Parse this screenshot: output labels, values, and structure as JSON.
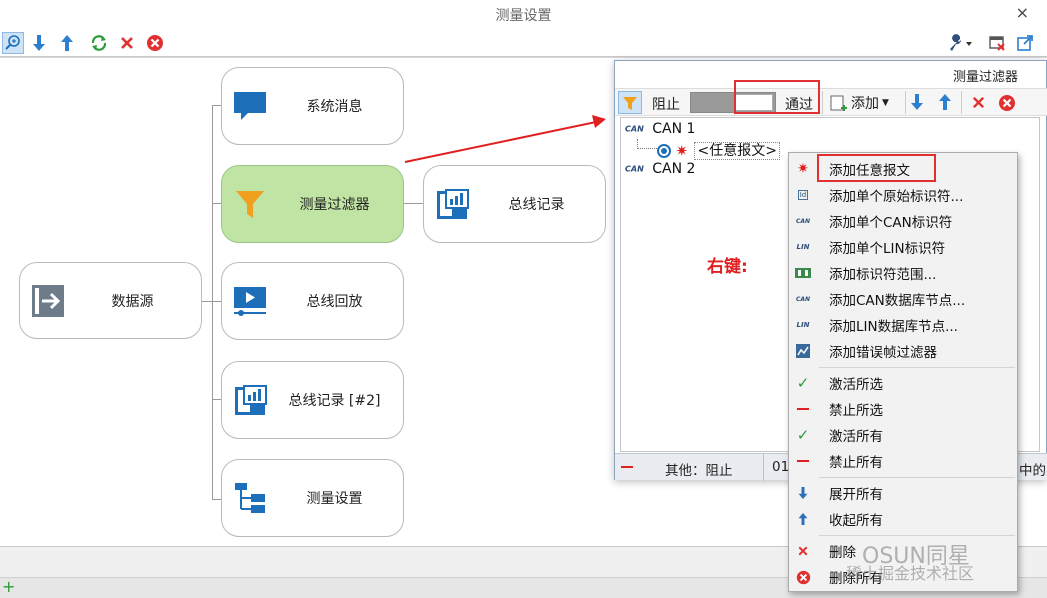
{
  "window": {
    "title": "测量设置",
    "close_label": "×"
  },
  "toolbar": {
    "left_icons": [
      "zoom-icon",
      "arrow-down-icon",
      "arrow-up-icon",
      "refresh-icon",
      "delete-icon",
      "delete-all-icon"
    ],
    "right_icons": [
      "wrench-icon",
      "window-close-icon",
      "export-icon"
    ]
  },
  "nodes": {
    "datasource": "数据源",
    "system_messages": "系统消息",
    "measurement_filter": "测量过滤器",
    "bus_logging_main": "总线记录",
    "bus_replay": "总线回放",
    "bus_logging_2": "总线记录 [#2]",
    "measurement_setup": "测量设置"
  },
  "dialog": {
    "title": "测量过滤器",
    "block_label": "阻止",
    "pass_label": "通过",
    "add_label": "添加",
    "tree": {
      "can1": "CAN 1",
      "can1_child": "<任意报文>",
      "can2": "CAN 2",
      "can_badge": "CAN"
    },
    "status": {
      "text": "其他：阻止",
      "code": "01",
      "right_fragment": "中的"
    }
  },
  "annotation": {
    "right_click": "右键:"
  },
  "context_menu": {
    "items": [
      {
        "label": "添加任意报文",
        "icon": "asterisk-icon"
      },
      {
        "label": "添加单个原始标识符...",
        "icon": "id-icon"
      },
      {
        "label": "添加单个CAN标识符",
        "icon": "can-icon"
      },
      {
        "label": "添加单个LIN标识符",
        "icon": "lin-icon"
      },
      {
        "label": "添加标识符范围...",
        "icon": "range-icon"
      },
      {
        "label": "添加CAN数据库节点...",
        "icon": "can-icon"
      },
      {
        "label": "添加LIN数据库节点...",
        "icon": "lin-icon"
      },
      {
        "label": "添加错误帧过滤器",
        "icon": "error-frame-icon"
      },
      {
        "label": "激活所选",
        "icon": "check-icon"
      },
      {
        "label": "禁止所选",
        "icon": "minus-icon"
      },
      {
        "label": "激活所有",
        "icon": "check-icon"
      },
      {
        "label": "禁止所有",
        "icon": "minus-icon"
      },
      {
        "label": "展开所有",
        "icon": "arrow-down-icon"
      },
      {
        "label": "收起所有",
        "icon": "arrow-up-icon"
      },
      {
        "label": "删除",
        "icon": "x-icon"
      },
      {
        "label": "删除所有",
        "icon": "delete-all-icon"
      }
    ],
    "icon_text": {
      "id": "Id",
      "can": "CAN",
      "lin": "LIN"
    }
  },
  "watermark": {
    "line1": "OSUN同星",
    "line2": "稀土掘金技术社区"
  },
  "colors": {
    "accent_blue": "#1c6fb8",
    "active_node": "#bfe4a4",
    "filter_orange": "#f0a01e",
    "annotation_red": "#e02020",
    "check_green": "#2e9a3a"
  }
}
